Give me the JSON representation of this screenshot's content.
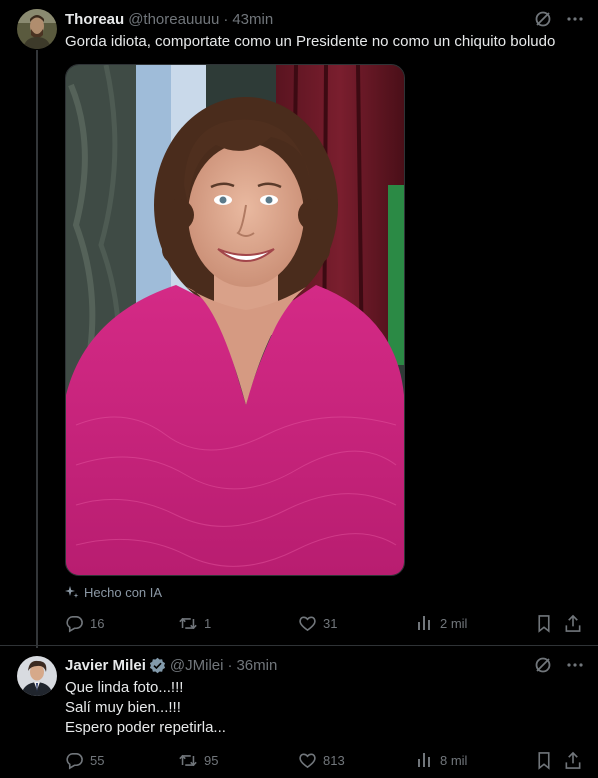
{
  "colors": {
    "background": "#000000",
    "text_primary": "#e7e9ea",
    "text_secondary": "#71767b",
    "verified_badge": "#829aab",
    "thread_line": "#333639"
  },
  "tweets": [
    {
      "display_name": "Thoreau",
      "handle": "@thoreauuuu",
      "separator": "·",
      "time": "43min",
      "text_lines": [
        "Gorda idiota, comportate como un Presidente no como un chiquito boludo"
      ],
      "ai_label": "Hecho con IA",
      "stats": {
        "replies": "16",
        "retweets": "1",
        "likes": "31",
        "views": "2 mil"
      },
      "icons": [
        "grok-icon",
        "more-icon",
        "reply-icon",
        "retweet-icon",
        "like-icon",
        "views-icon",
        "bookmark-icon",
        "share-icon",
        "sparkle-icon"
      ]
    },
    {
      "display_name": "Javier Milei",
      "verified": true,
      "handle": "@JMilei",
      "separator": "·",
      "time": "36min",
      "text_lines": [
        "Que linda foto...!!!",
        "Salí muy bien...!!!",
        "Espero poder repetirla..."
      ],
      "stats": {
        "replies": "55",
        "retweets": "95",
        "likes": "813",
        "views": "8 mil"
      },
      "icons": [
        "grok-icon",
        "more-icon",
        "reply-icon",
        "retweet-icon",
        "like-icon",
        "views-icon",
        "bookmark-icon",
        "share-icon",
        "verified-icon"
      ]
    }
  ]
}
